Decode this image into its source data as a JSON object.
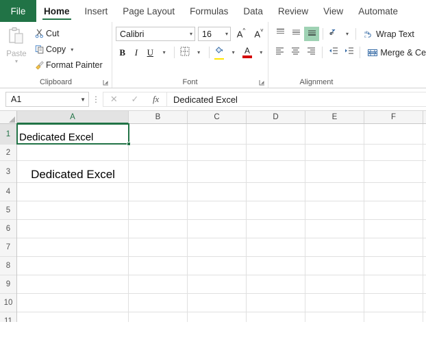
{
  "tabs": [
    {
      "label": "File",
      "active": false,
      "file": true
    },
    {
      "label": "Home",
      "active": true
    },
    {
      "label": "Insert",
      "active": false
    },
    {
      "label": "Page Layout",
      "active": false
    },
    {
      "label": "Formulas",
      "active": false
    },
    {
      "label": "Data",
      "active": false
    },
    {
      "label": "Review",
      "active": false
    },
    {
      "label": "View",
      "active": false
    },
    {
      "label": "Automate",
      "active": false
    }
  ],
  "ribbon": {
    "clipboard": {
      "label": "Clipboard",
      "paste": "Paste",
      "cut": "Cut",
      "copy": "Copy",
      "format_painter": "Format Painter"
    },
    "font": {
      "label": "Font",
      "font_name": "Calibri",
      "font_size": "16",
      "bold": "B",
      "italic": "I",
      "underline": "U"
    },
    "alignment": {
      "label": "Alignment",
      "wrap_text": "Wrap Text",
      "merge_center": "Merge & Ce"
    }
  },
  "formula_bar": {
    "name_box": "A1",
    "formula": "Dedicated Excel"
  },
  "grid": {
    "columns": [
      "A",
      "B",
      "C",
      "D",
      "E",
      "F"
    ],
    "rows": [
      "1",
      "2",
      "3",
      "4",
      "5",
      "6",
      "7",
      "8",
      "9",
      "10",
      "11"
    ],
    "selected_column": "A",
    "selected_row": "1",
    "cells": {
      "A1": "Dedicated Excel",
      "A3": "Dedicated Excel"
    }
  },
  "colors": {
    "excel_green": "#217346",
    "highlight_green": "#9fd2b4",
    "fill_yellow": "#ffe600",
    "font_red": "#d40000"
  }
}
